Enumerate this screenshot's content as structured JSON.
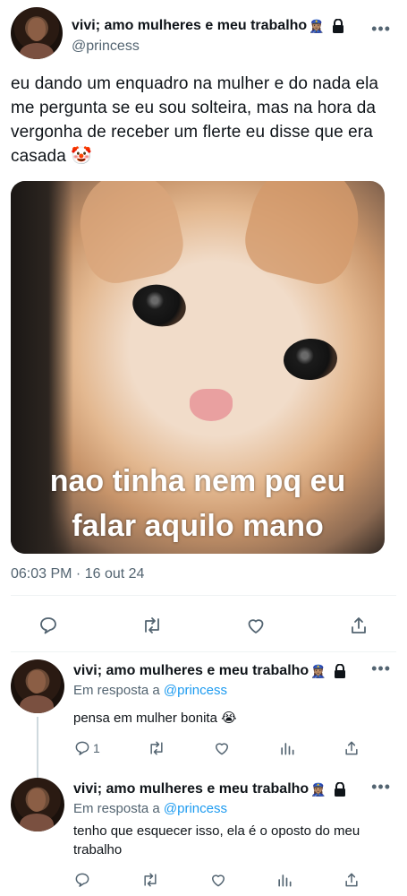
{
  "main": {
    "display_name": "vivi; amo mulheres e meu trabalho",
    "name_emoji": "👮🏽‍♀️",
    "handle": "@princess",
    "text": "eu dando um enquadro na mulher e do nada ela me pergunta se eu sou solteira, mas na hora da vergonha de receber um flerte eu disse que era casada 🤡",
    "media_caption_line1": "nao tinha nem pq eu",
    "media_caption_line2": "falar aquilo mano",
    "timestamp": "06:03 PM · 16 out 24",
    "more": "•••"
  },
  "replies": [
    {
      "display_name": "vivi; amo mulheres e meu trabalho",
      "name_emoji": "👮🏽‍♀️",
      "reply_prefix": "Em resposta a",
      "reply_mention": "@princess",
      "text": "pensa em mulher bonita 😭",
      "reply_count": "1",
      "more": "•••"
    },
    {
      "display_name": "vivi; amo mulheres e meu trabalho",
      "name_emoji": "👮🏽‍♀️",
      "reply_prefix": "Em resposta a",
      "reply_mention": "@princess",
      "text": "tenho que esquecer isso, ela é o oposto do meu trabalho",
      "reply_count": "",
      "more": "•••"
    }
  ],
  "colors": {
    "text": "#0f1419",
    "secondary": "#536471",
    "link": "#1d9bf0",
    "divider": "#eff3f4"
  },
  "icons": [
    "lock-icon",
    "reply-icon",
    "retweet-icon",
    "like-icon",
    "views-icon",
    "share-icon",
    "more-icon"
  ]
}
